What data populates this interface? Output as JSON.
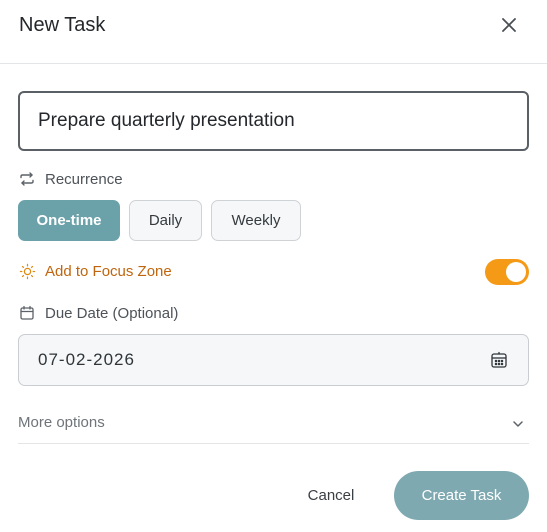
{
  "dialog": {
    "title": "New Task",
    "close_icon": "close-icon"
  },
  "task": {
    "value": "Prepare quarterly presentation"
  },
  "recurrence": {
    "label": "Recurrence",
    "icon": "repeat-icon",
    "options": [
      {
        "label": "One-time",
        "selected": true
      },
      {
        "label": "Daily",
        "selected": false
      },
      {
        "label": "Weekly",
        "selected": false
      }
    ]
  },
  "focus": {
    "label": "Add to Focus Zone",
    "icon": "sun-icon",
    "enabled": true,
    "color": "#c0650e",
    "toggle_color": "#f59a16"
  },
  "due_date": {
    "label": "Due Date (Optional)",
    "icon": "calendar-icon",
    "value": "07-02-2026"
  },
  "more_options": {
    "label": "More options",
    "icon": "chevron-down-icon"
  },
  "footer": {
    "cancel_label": "Cancel",
    "create_label": "Create Task"
  },
  "colors": {
    "accent": "#6ba2aa",
    "create_button": "#7fa9b0"
  }
}
